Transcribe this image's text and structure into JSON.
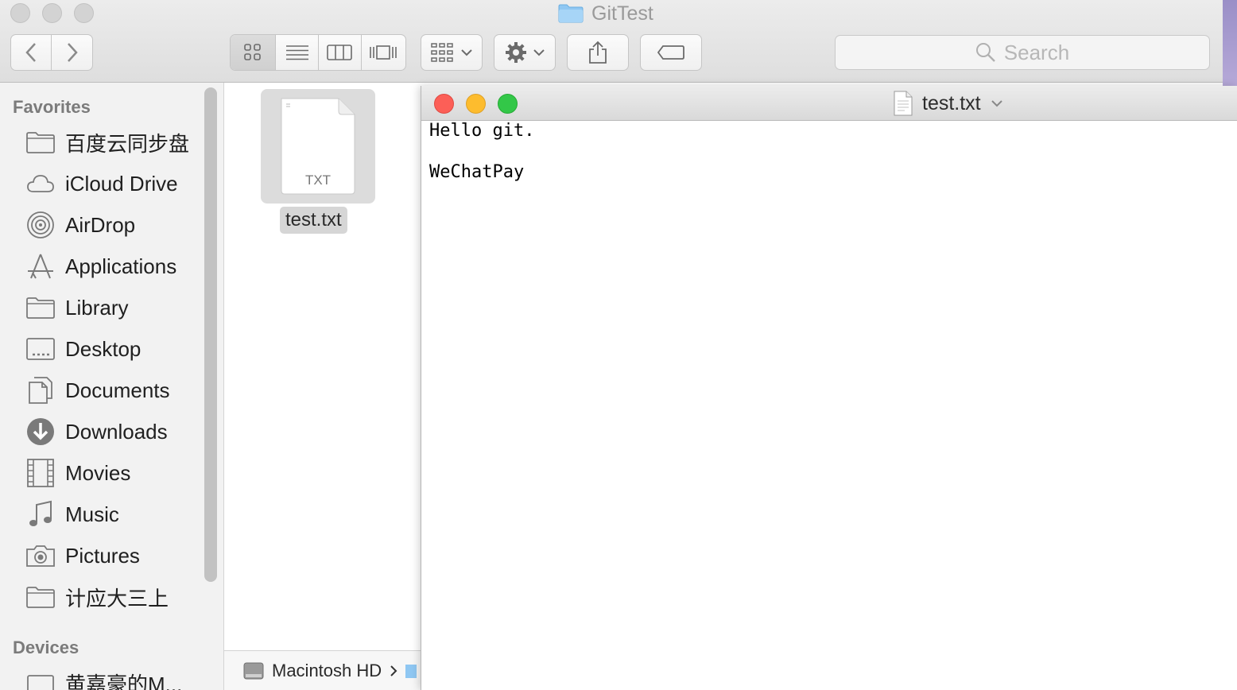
{
  "finder": {
    "title": "GitTest",
    "toolbar": {
      "search_placeholder": "Search"
    },
    "sidebar": {
      "favorites_header": "Favorites",
      "favorites": [
        {
          "label": "百度云同步盘",
          "icon": "folder-icon"
        },
        {
          "label": "iCloud Drive",
          "icon": "cloud-icon"
        },
        {
          "label": "AirDrop",
          "icon": "airdrop-icon"
        },
        {
          "label": "Applications",
          "icon": "applications-icon"
        },
        {
          "label": "Library",
          "icon": "folder-icon"
        },
        {
          "label": "Desktop",
          "icon": "desktop-icon"
        },
        {
          "label": "Documents",
          "icon": "documents-icon"
        },
        {
          "label": "Downloads",
          "icon": "downloads-icon"
        },
        {
          "label": "Movies",
          "icon": "movies-icon"
        },
        {
          "label": "Music",
          "icon": "music-icon"
        },
        {
          "label": "Pictures",
          "icon": "pictures-icon"
        },
        {
          "label": "计应大三上",
          "icon": "folder-icon"
        }
      ],
      "devices_header": "Devices",
      "devices": [
        {
          "label": "黄嘉豪的M...",
          "icon": "computer-icon"
        }
      ]
    },
    "files": [
      {
        "name": "test.txt",
        "type_label": "TXT"
      }
    ],
    "pathbar": {
      "items": [
        "Macintosh HD"
      ]
    }
  },
  "textedit": {
    "title": "test.txt",
    "lines": [
      "Hello git.",
      "",
      "WeChatPay"
    ]
  }
}
